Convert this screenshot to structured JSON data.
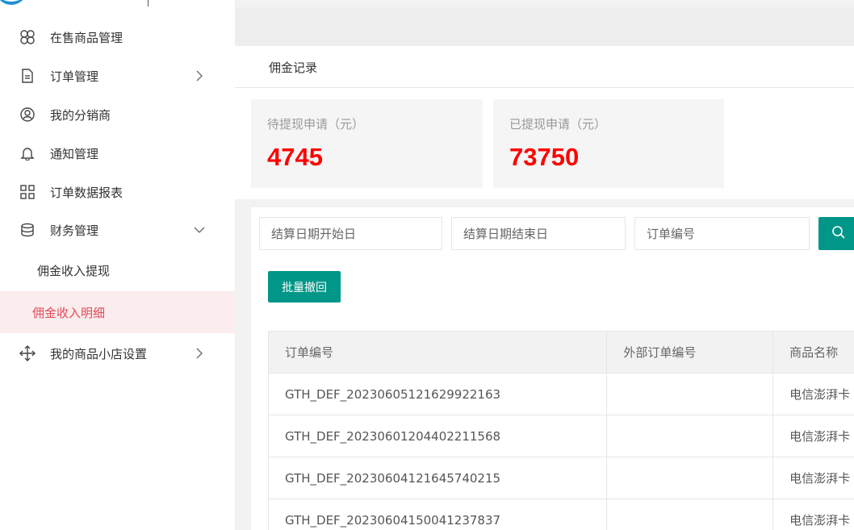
{
  "sidebar": {
    "items": [
      {
        "name": "on-sale",
        "label": "在售商品管理",
        "icon": "clover-icon"
      },
      {
        "name": "orders",
        "label": "订单管理",
        "icon": "document-icon"
      },
      {
        "name": "distributors",
        "label": "我的分销商",
        "icon": "user-circle-icon"
      },
      {
        "name": "notifications",
        "label": "通知管理",
        "icon": "bell-icon"
      },
      {
        "name": "order-report",
        "label": "订单数据报表",
        "icon": "grid-icon"
      },
      {
        "name": "finance",
        "label": "财务管理",
        "icon": "database-icon"
      },
      {
        "name": "shop-settings",
        "label": "我的商品小店设置",
        "icon": "move-icon"
      }
    ],
    "finance_sub": [
      {
        "label": "佣金收入提现",
        "active": false
      },
      {
        "label": "佣金收入明细",
        "active": true
      }
    ]
  },
  "breadcrumb": "佣金记录",
  "stats": [
    {
      "label": "待提现申请（元）",
      "value": "4745"
    },
    {
      "label": "已提现申请（元）",
      "value": "73750"
    }
  ],
  "filters": {
    "start_placeholder": "结算日期开始日",
    "end_placeholder": "结算日期结束日",
    "order_placeholder": "订单编号"
  },
  "batch_button": "批量撤回",
  "table": {
    "headers": [
      "订单编号",
      "外部订单编号",
      "商品名称"
    ],
    "rows": [
      [
        "GTH_DEF_20230605121629922163",
        "",
        "电信澎湃卡"
      ],
      [
        "GTH_DEF_20230601204402211568",
        "",
        "电信澎湃卡"
      ],
      [
        "GTH_DEF_20230604121645740215",
        "",
        "电信澎湃卡"
      ],
      [
        "GTH_DEF_20230604150041237837",
        "",
        "电信澎湃卡"
      ]
    ]
  },
  "colors": {
    "accent": "#009688",
    "stat_value": "#ff0000",
    "active_menu": "#e04a5c",
    "active_bg": "#fbeced"
  }
}
